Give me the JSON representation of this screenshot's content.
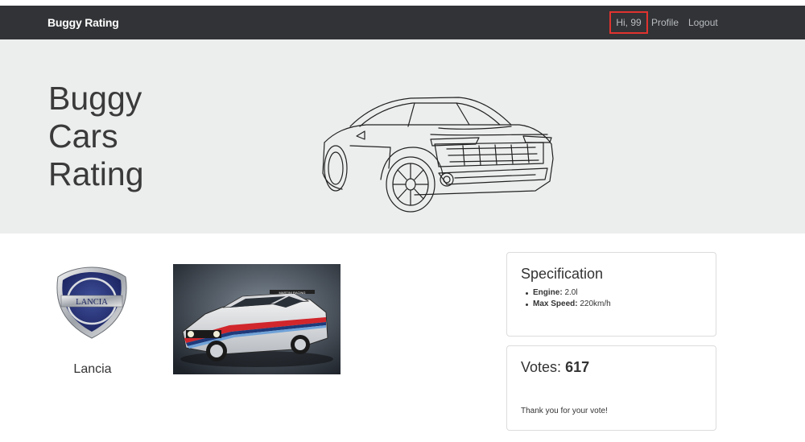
{
  "navbar": {
    "brand": "Buggy Rating",
    "greeting": "Hi, 99",
    "profile_label": "Profile",
    "logout_label": "Logout",
    "bg_color": "#313336",
    "highlight_color": "#e0332f"
  },
  "hero": {
    "title_line1": "Buggy",
    "title_line2": "Cars",
    "title_line3": "Rating",
    "bg_color": "#eceded",
    "image": "sports-car-line-drawing"
  },
  "make": {
    "name": "Lancia",
    "logo": "lancia-shield-logo",
    "logo_text": "LANCIA"
  },
  "model": {
    "photo": "lancia-delta-rally-car-photo",
    "photo_livery_text": "MARTINI RACING"
  },
  "specification": {
    "title": "Specification",
    "items": [
      {
        "label": "Engine:",
        "value": "2.0l"
      },
      {
        "label": "Max Speed:",
        "value": "220km/h"
      }
    ]
  },
  "votes": {
    "label": "Votes:",
    "count": "617",
    "message": "Thank you for your vote!"
  }
}
